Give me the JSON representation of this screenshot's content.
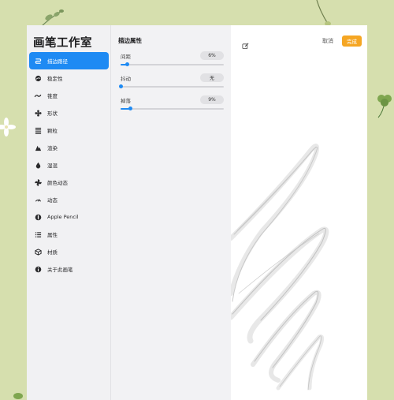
{
  "app": {
    "title": "画笔工作室"
  },
  "sidebar": {
    "items": [
      {
        "label": "描边路径",
        "icon": "stroke-path-icon",
        "active": true
      },
      {
        "label": "稳定性",
        "icon": "stabilization-icon"
      },
      {
        "label": "锥度",
        "icon": "taper-icon"
      },
      {
        "label": "形状",
        "icon": "shape-icon"
      },
      {
        "label": "颗粒",
        "icon": "grain-icon"
      },
      {
        "label": "渲染",
        "icon": "rendering-icon"
      },
      {
        "label": "湿混",
        "icon": "wet-mix-icon"
      },
      {
        "label": "颜色动态",
        "icon": "color-dynamics-icon"
      },
      {
        "label": "动态",
        "icon": "dynamics-icon"
      },
      {
        "label": "Apple Pencil",
        "icon": "apple-pencil-icon"
      },
      {
        "label": "属性",
        "icon": "properties-icon"
      },
      {
        "label": "材质",
        "icon": "materials-icon"
      },
      {
        "label": "关于此画笔",
        "icon": "info-icon"
      }
    ]
  },
  "settings": {
    "title": "描边属性",
    "rows": [
      {
        "label": "间距",
        "value": "6%",
        "level": 0.06
      },
      {
        "label": "抖动",
        "value": "无",
        "level": 0.0
      },
      {
        "label": "掉落",
        "value": "9%",
        "level": 0.09
      }
    ]
  },
  "preview": {
    "cancel_label": "取消",
    "done_label": "完成"
  },
  "colors": {
    "accent": "#1e8af3",
    "done": "#f5a623",
    "background": "#d6dfae"
  }
}
